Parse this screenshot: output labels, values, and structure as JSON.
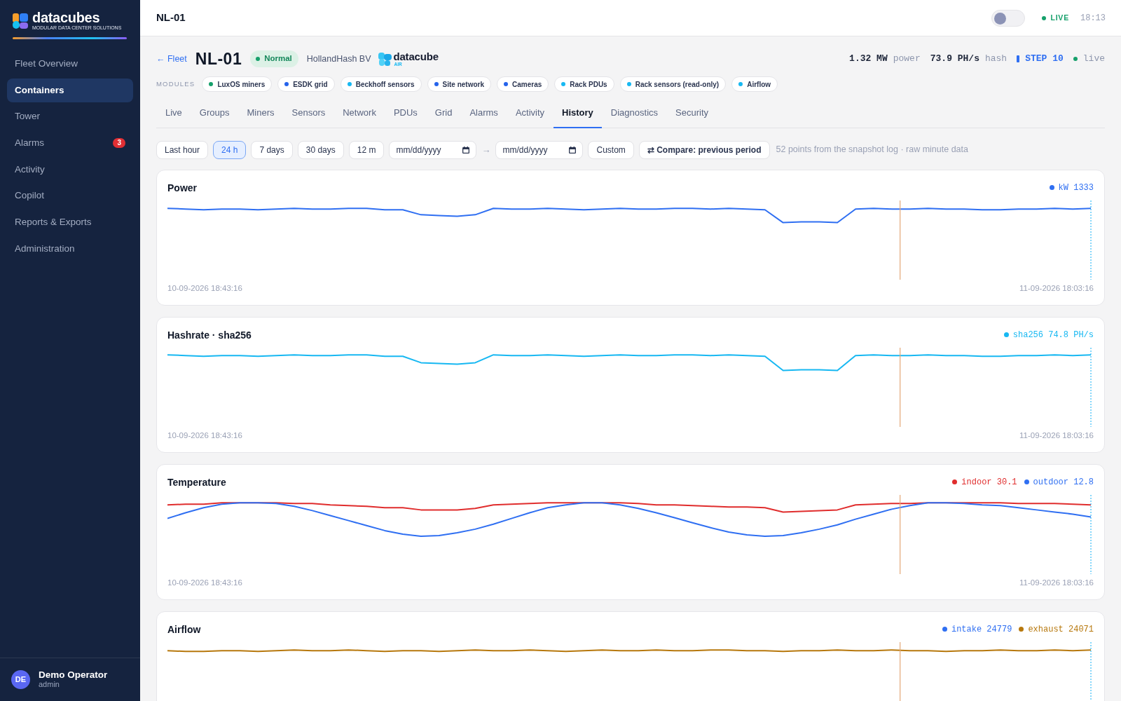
{
  "sidebar": {
    "logo": {
      "name": "datacubes",
      "tagline": "MODULAR DATA CENTER SOLUTIONS"
    },
    "items": [
      {
        "label": "Fleet Overview",
        "selected": false
      },
      {
        "label": "Containers",
        "selected": true
      },
      {
        "label": "Tower",
        "selected": false
      },
      {
        "label": "Alarms",
        "selected": false,
        "badge": "3"
      },
      {
        "label": "Activity",
        "selected": false
      },
      {
        "label": "Copilot",
        "selected": false
      },
      {
        "label": "Reports & Exports",
        "selected": false
      },
      {
        "label": "Administration",
        "selected": false
      }
    ],
    "user": {
      "initials": "DE",
      "name": "Demo Operator",
      "role": "admin"
    }
  },
  "topbar": {
    "title": "NL-01",
    "toggle": {
      "on": false
    },
    "status": "LIVE",
    "time": "18:13"
  },
  "header": {
    "back": "← Fleet",
    "title": "NL-01",
    "status": "Normal",
    "owner": "HollandHash BV",
    "brand": {
      "name": "datacube",
      "sub": "AIR"
    },
    "stats": [
      {
        "kind": "metric",
        "value": "1.32 MW",
        "unit": "power"
      },
      {
        "kind": "metric",
        "value": "73.9 PH/s",
        "unit": "hash"
      },
      {
        "kind": "step",
        "value": "STEP 10"
      },
      {
        "kind": "live",
        "value": "live"
      }
    ]
  },
  "modules": {
    "label": "MODULES",
    "items": [
      {
        "label": "LuxOS miners",
        "color": "#16a06b"
      },
      {
        "label": "ESDK grid",
        "color": "#2563eb"
      },
      {
        "label": "Beckhoff sensors",
        "color": "#17b8f2"
      },
      {
        "label": "Site network",
        "color": "#2563eb"
      },
      {
        "label": "Cameras",
        "color": "#2563eb"
      },
      {
        "label": "Rack PDUs",
        "color": "#17b8f2"
      },
      {
        "label": "Rack sensors (read-only)",
        "color": "#17b8f2"
      },
      {
        "label": "Airflow",
        "color": "#17b8f2"
      }
    ]
  },
  "tabs": [
    {
      "label": "Live",
      "selected": false
    },
    {
      "label": "Groups",
      "selected": false
    },
    {
      "label": "Miners",
      "selected": false
    },
    {
      "label": "Sensors",
      "selected": false
    },
    {
      "label": "Network",
      "selected": false
    },
    {
      "label": "PDUs",
      "selected": false
    },
    {
      "label": "Grid",
      "selected": false
    },
    {
      "label": "Alarms",
      "selected": false
    },
    {
      "label": "Activity",
      "selected": false
    },
    {
      "label": "History",
      "selected": true
    },
    {
      "label": "Diagnostics",
      "selected": false
    },
    {
      "label": "Security",
      "selected": false
    }
  ],
  "filters": {
    "ranges": [
      {
        "label": "Last hour",
        "selected": false
      },
      {
        "label": "24 h",
        "selected": true
      },
      {
        "label": "7 days",
        "selected": false
      },
      {
        "label": "30 days",
        "selected": false
      },
      {
        "label": "12 m",
        "selected": false
      }
    ],
    "from": {
      "placeholder": "mm/dd/yyyy"
    },
    "arrow": "→",
    "to": {
      "placeholder": "mm/dd/yyyy"
    },
    "custom_button": "Custom",
    "compare_button": "⇄ Compare: previous period",
    "note": "52 points from the snapshot log · raw minute data"
  },
  "charts": [
    {
      "title": "Power",
      "legend": [
        {
          "label": "kW 1333",
          "color": "#2f6ff2"
        }
      ],
      "start": "10-09-2026 18:43:16",
      "end": "11-09-2026 18:03:16"
    },
    {
      "title": "Hashrate · sha256",
      "legend": [
        {
          "label": "sha256 74.8 PH/s",
          "color": "#17b8f2"
        }
      ],
      "start": "10-09-2026 18:43:16",
      "end": "11-09-2026 18:03:16"
    },
    {
      "title": "Temperature",
      "legend": [
        {
          "label": "indoor 30.1",
          "color": "#e02d2d"
        },
        {
          "label": "outdoor 12.8",
          "color": "#2f6ff2"
        }
      ],
      "start": "10-09-2026 18:43:16",
      "end": "11-09-2026 18:03:16"
    },
    {
      "title": "Airflow",
      "legend": [
        {
          "label": "intake 24779",
          "color": "#2f6ff2"
        },
        {
          "label": "exhaust 24071",
          "color": "#b7780d"
        }
      ]
    }
  ]
}
